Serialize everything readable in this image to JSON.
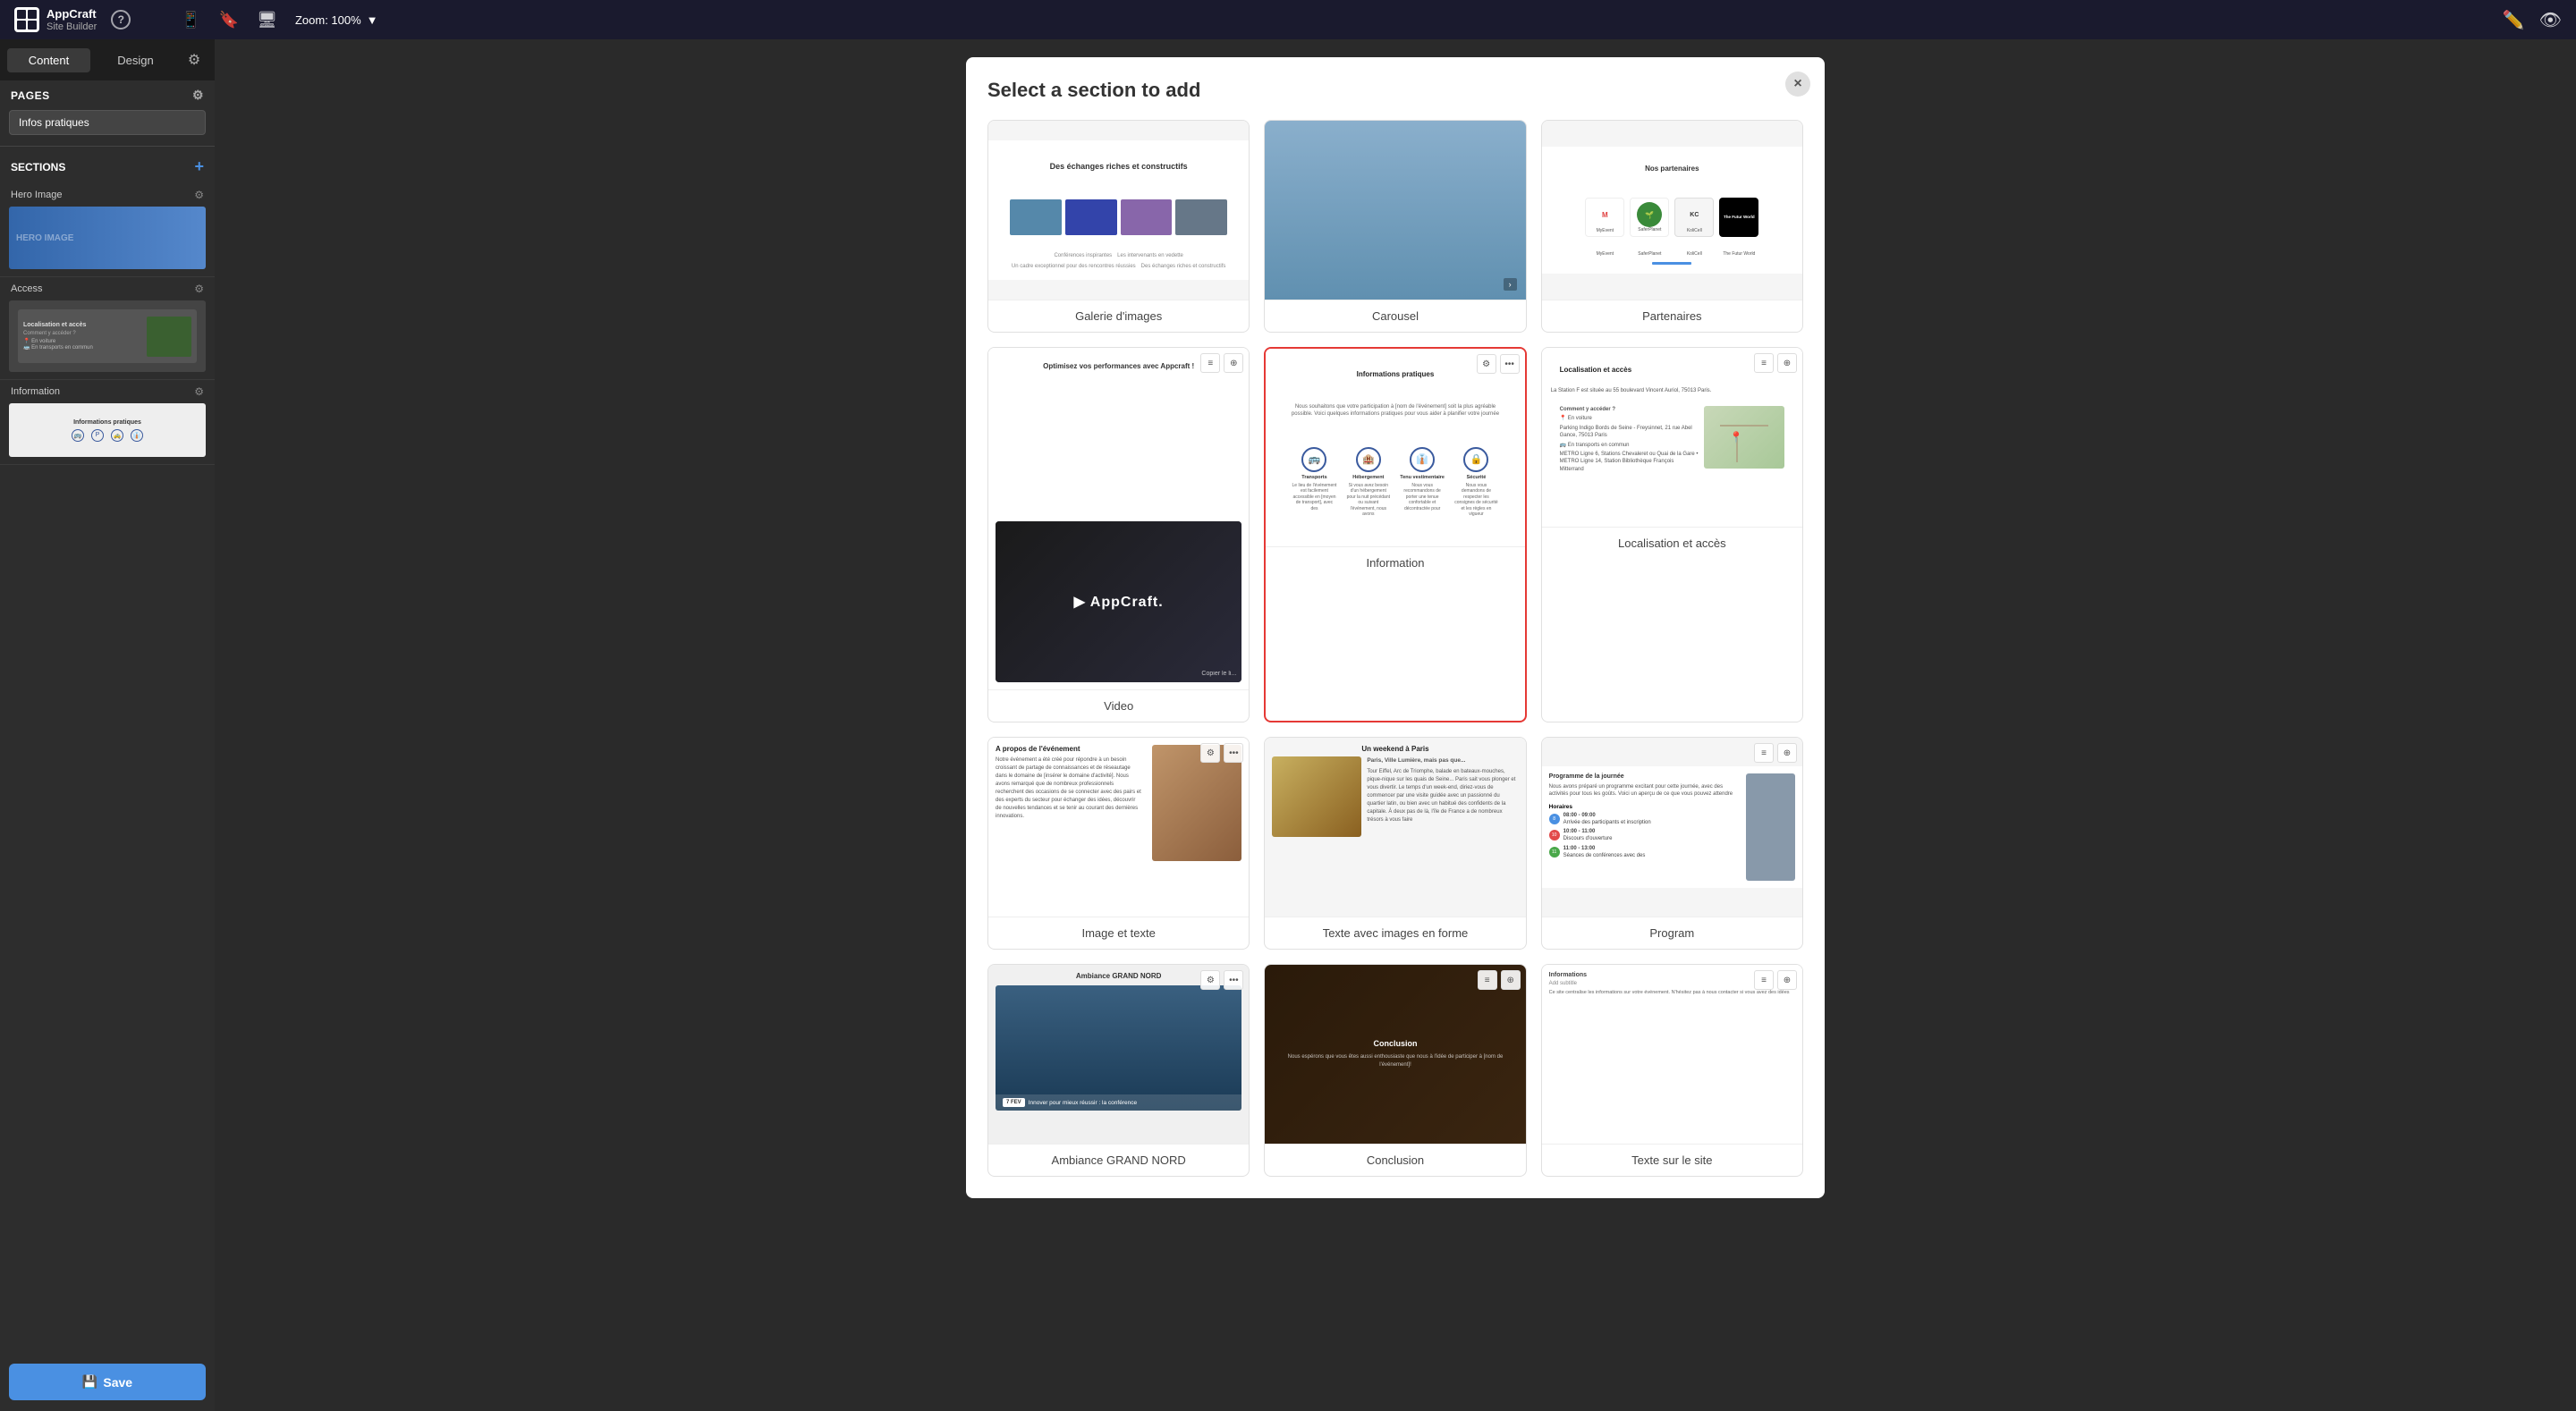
{
  "app": {
    "name": "AppCraft",
    "subtitle": "Site Builder",
    "help_label": "?"
  },
  "topbar": {
    "zoom_label": "Zoom: 100%",
    "zoom_icon": "▼",
    "edit_icon": "✏",
    "preview_icon": "👁"
  },
  "sidebar": {
    "tab_content": "Content",
    "tab_design": "Design",
    "tab_settings_icon": "⚙",
    "pages_label": "PAGES",
    "pages_settings_icon": "⚙",
    "current_page": "Infos pratiques",
    "sections_label": "SECTIONS",
    "sections_add_icon": "+",
    "sections": [
      {
        "label": "Hero Image",
        "has_gear": true
      },
      {
        "label": "Access",
        "has_gear": true
      },
      {
        "label": "Information",
        "has_gear": true
      }
    ],
    "save_label": "Save",
    "save_icon": "💾"
  },
  "modal": {
    "title": "Select a section to add",
    "close_icon": "×",
    "sections": [
      {
        "id": "galerie",
        "label": "Galerie d'images",
        "selected": false,
        "title_preview": "Des échanges riches et constructifs"
      },
      {
        "id": "carousel",
        "label": "Carousel",
        "selected": false
      },
      {
        "id": "partenaires",
        "label": "Partenaires",
        "selected": false,
        "title_preview": "Nos partenaires",
        "partners": [
          "MyEvent",
          "SaferPlanet",
          "KoliCell",
          "The Futur World"
        ]
      },
      {
        "id": "video",
        "label": "Video",
        "selected": false,
        "title_preview": "Optimisez vos performances avec Appcraft !"
      },
      {
        "id": "information",
        "label": "Information",
        "selected": true,
        "title_preview": "Informations pratiques",
        "desc": "Nous souhaitons que votre participation à [nom de l'événement] soit la plus agréable possible. Voici quelques informations pratiques pour vous aider à planifier votre journée",
        "icons": [
          {
            "icon": "🚌",
            "label": "Transports",
            "desc": "Le lieu de l'événement est facilement accessible en [moyen de transport], avec des"
          },
          {
            "icon": "🏨",
            "label": "Hébergement",
            "desc": "Si vous avez besoin d'un hébergement pour la nuit précédant ou suivant l'événement, nous avons"
          },
          {
            "icon": "👔",
            "label": "Tenu vestimentaire",
            "desc": "Nous vous recommandons de porter une tenue confortable et décontractée pour"
          },
          {
            "icon": "🔒",
            "label": "Sécurité",
            "desc": "Nous vous demandons de respecter les consignes de sécurité et les règles en vigueur"
          }
        ]
      },
      {
        "id": "access",
        "label": "Localisation et accès",
        "selected": false,
        "title_preview": "Localisation et accès"
      },
      {
        "id": "image-texte",
        "label": "Image et texte",
        "selected": false,
        "title_preview": "A propos de l'événement"
      },
      {
        "id": "texte-images",
        "label": "Texte avec images en forme",
        "selected": false,
        "title_preview": "Un weekend à Paris",
        "subtitle_preview": "Paris, Ville Lumière, mais pas que..."
      },
      {
        "id": "program",
        "label": "Program",
        "selected": false,
        "title_preview": "Programme de la journée",
        "desc_preview": "Nous avons préparé un programme excitant pour cette journée, avec des activités pour tous les goûts. Voici un aperçu de ce que vous pouvez attendre",
        "items": [
          {
            "time": "08:00 - 09:00",
            "label": "Arrivée des participants et inscription",
            "color": "#4a90e2"
          },
          {
            "time": "10:00 - 11:00",
            "label": "Discours d'ouverture",
            "color": "#e24a4a"
          },
          {
            "time": "11:00 - 13:00",
            "label": "Séances de conférences avec des",
            "color": "#4ae24a"
          }
        ]
      },
      {
        "id": "ambiance",
        "label": "Ambiance GRAND NORD",
        "selected": false,
        "banner_text": "Innover pour mieux réussir : la conférence"
      },
      {
        "id": "conclusion",
        "label": "Conclusion",
        "selected": false,
        "title_preview": "Conclusion",
        "desc": "Nous espérons que vous êtes aussi enthousiaste que nous à l'idée de participer à [nom de l'événement]!"
      },
      {
        "id": "texte-site",
        "label": "Texte sur le site",
        "selected": false,
        "title_preview": "Informations",
        "sub": "Add subtitle",
        "body": "Ce site centralise les informations sur votre événement. N'hésitez pas à nous contacter si vous avez des idées"
      }
    ]
  },
  "background": {
    "text": "appcraft"
  }
}
